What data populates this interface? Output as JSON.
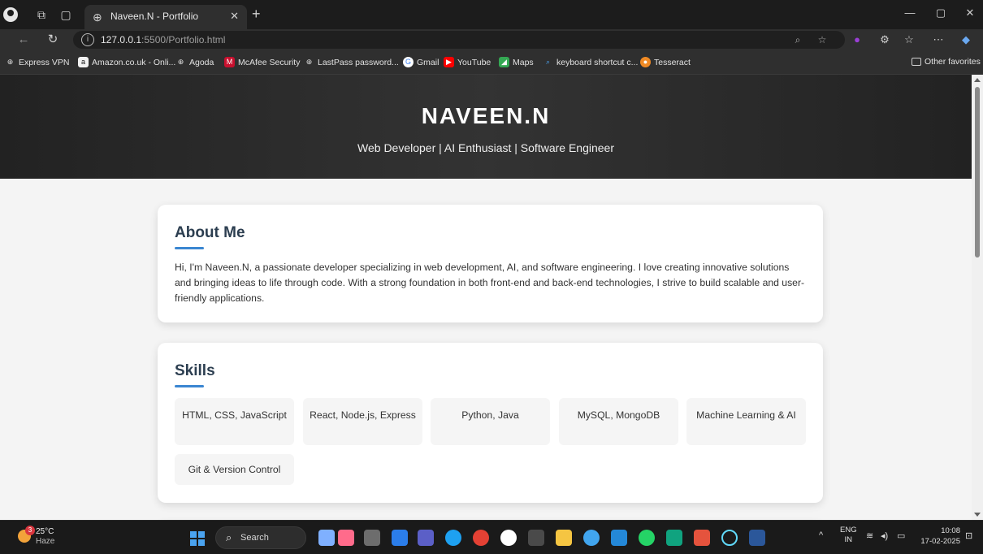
{
  "browser": {
    "tab_title": "Naveen.N - Portfolio",
    "url_host": "127.0.0.1",
    "url_rest": ":5500/Portfolio.html",
    "bookmarks": [
      {
        "label": "Express VPN",
        "icon": "globe-icon"
      },
      {
        "label": "Amazon.co.uk - Onli...",
        "icon": "amazon-icon"
      },
      {
        "label": "Agoda",
        "icon": "globe-icon"
      },
      {
        "label": "McAfee Security",
        "icon": "mcafee-icon"
      },
      {
        "label": "LastPass password...",
        "icon": "globe-icon"
      },
      {
        "label": "Gmail",
        "icon": "google-icon"
      },
      {
        "label": "YouTube",
        "icon": "youtube-icon"
      },
      {
        "label": "Maps",
        "icon": "maps-icon"
      },
      {
        "label": "keyboard shortcut c...",
        "icon": "search-icon"
      },
      {
        "label": "Tesseract",
        "icon": "tesseract-icon"
      }
    ],
    "other_favorites": "Other favorites"
  },
  "hero": {
    "name": "NAVEEN.N",
    "subtitle": "Web Developer | AI Enthusiast | Software Engineer"
  },
  "about": {
    "title": "About Me",
    "text": "Hi, I'm Naveen.N, a passionate developer specializing in web development, AI, and software engineering. I love creating innovative solutions and bringing ideas to life through code. With a strong foundation in both front-end and back-end technologies, I strive to build scalable and user-friendly applications."
  },
  "skills": {
    "title": "Skills",
    "items": [
      "HTML, CSS, JavaScript",
      "React, Node.js, Express",
      "Python, Java",
      "MySQL, MongoDB",
      "Machine Learning & AI",
      "Git & Version Control"
    ]
  },
  "taskbar": {
    "weather_temp": "25°C",
    "weather_desc": "Haze",
    "weather_badge": "3",
    "search_label": "Search",
    "lang_top": "ENG",
    "lang_bottom": "IN",
    "time": "10:08",
    "date": "17-02-2025"
  },
  "colors": {
    "accent": "#3a86d1",
    "heading": "#2c3e50",
    "hero_bg": "#2a2a2a"
  }
}
